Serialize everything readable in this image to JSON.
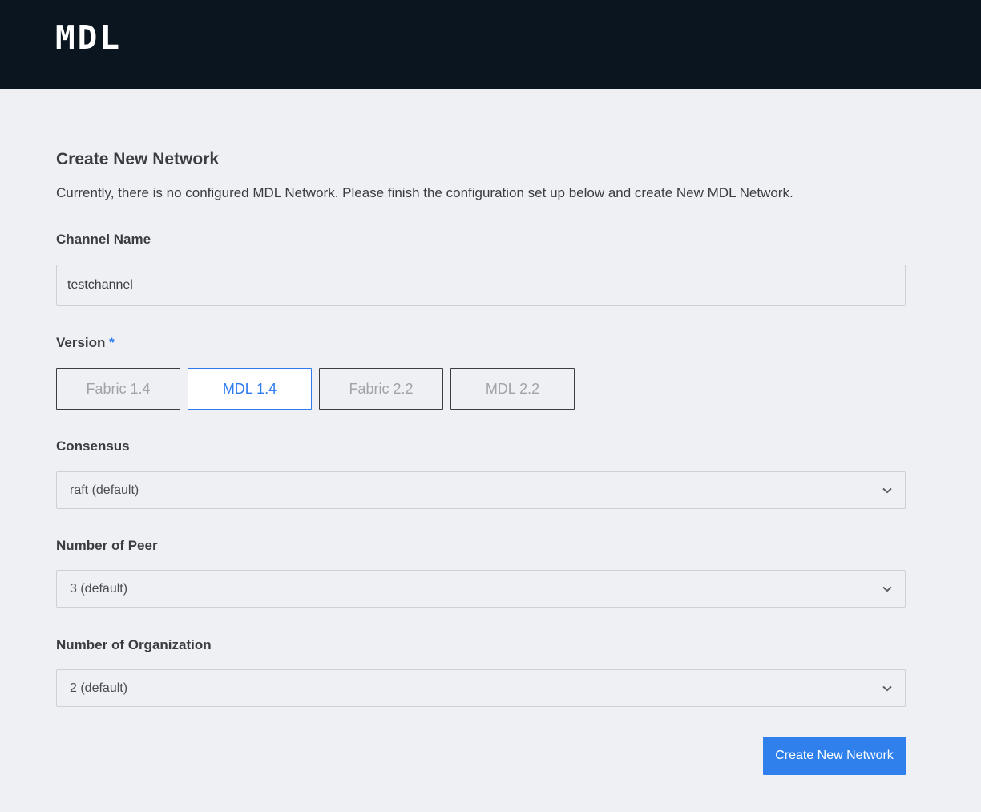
{
  "header": {
    "logo_text": "MDL"
  },
  "form": {
    "title": "Create New Network",
    "description": "Currently, there is no configured MDL Network. Please finish the configuration set up below and create New MDL Network.",
    "channel_name": {
      "label": "Channel Name",
      "value": "testchannel"
    },
    "version": {
      "label": "Version",
      "required_mark": "*",
      "options": [
        "Fabric 1.4",
        "MDL 1.4",
        "Fabric 2.2",
        "MDL 2.2"
      ],
      "selected": "MDL 1.4"
    },
    "consensus": {
      "label": "Consensus",
      "value": "raft (default)"
    },
    "peers": {
      "label": "Number of Peer",
      "value": "3 (default)"
    },
    "organizations": {
      "label": "Number of Organization",
      "value": "2 (default)"
    },
    "submit_label": "Create New Network"
  },
  "colors": {
    "header_bg": "#0b1520",
    "page_bg": "#eff0f3",
    "accent": "#2f7cf0",
    "button_bg": "#2f80ed"
  },
  "icons": {
    "select_arrow": "chevron-down-icon"
  }
}
